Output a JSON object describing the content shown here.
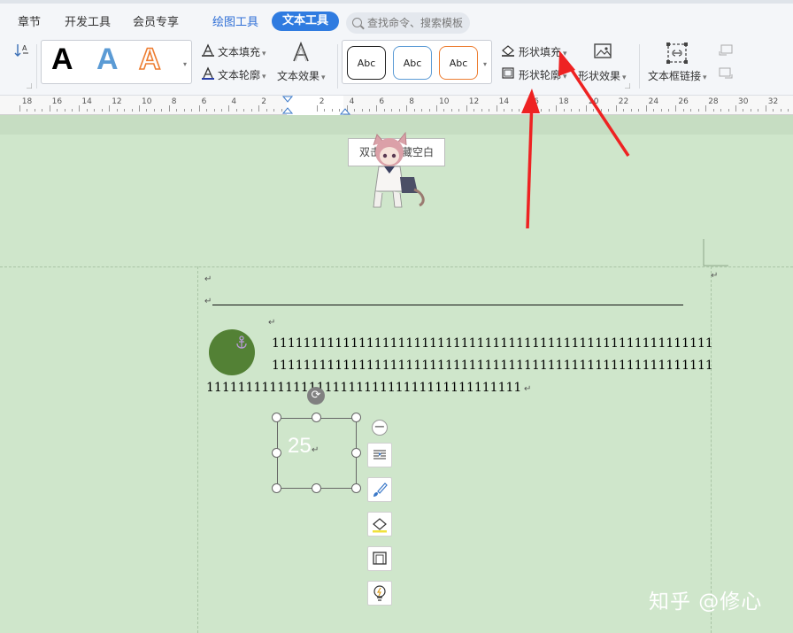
{
  "menu": {
    "items": [
      "章节",
      "开发工具",
      "会员专享",
      "绘图工具",
      "文本工具"
    ],
    "active": "文本工具",
    "search_placeholder": "查找命令、搜索模板"
  },
  "ribbon": {
    "text_fill": "文本填充",
    "text_outline": "文本轮廓",
    "text_effects": "文本效果",
    "shape_styles": [
      "Abc",
      "Abc",
      "Abc"
    ],
    "shape_fill": "形状填充",
    "shape_outline": "形状轮廓",
    "shape_effects": "形状效果",
    "textbox_link": "文本框链接",
    "style_letter": "A",
    "style_colors": [
      "#000000",
      "#5b9bd5",
      "#ed7d31"
    ]
  },
  "ruler": {
    "left_ticks": [
      "18",
      "16",
      "14",
      "12",
      "10",
      "8",
      "6",
      "4",
      "2"
    ],
    "right_ticks": [
      "2",
      "4",
      "6",
      "8",
      "10",
      "12",
      "14",
      "16",
      "18",
      "20",
      "22",
      "24",
      "26",
      "28",
      "30",
      "32"
    ]
  },
  "document": {
    "tooltip": "双击可隐藏空白",
    "return_mark": "↵",
    "line1": "11111111111111111111111111111111111111111111111111111111",
    "line2": "11111111111111111111111111111111111111111111111111111111",
    "line3": "1111111111111111111111111111111111111111",
    "textbox_value": "25",
    "circle_color": "#538135"
  },
  "watermark": "知乎 @修心"
}
